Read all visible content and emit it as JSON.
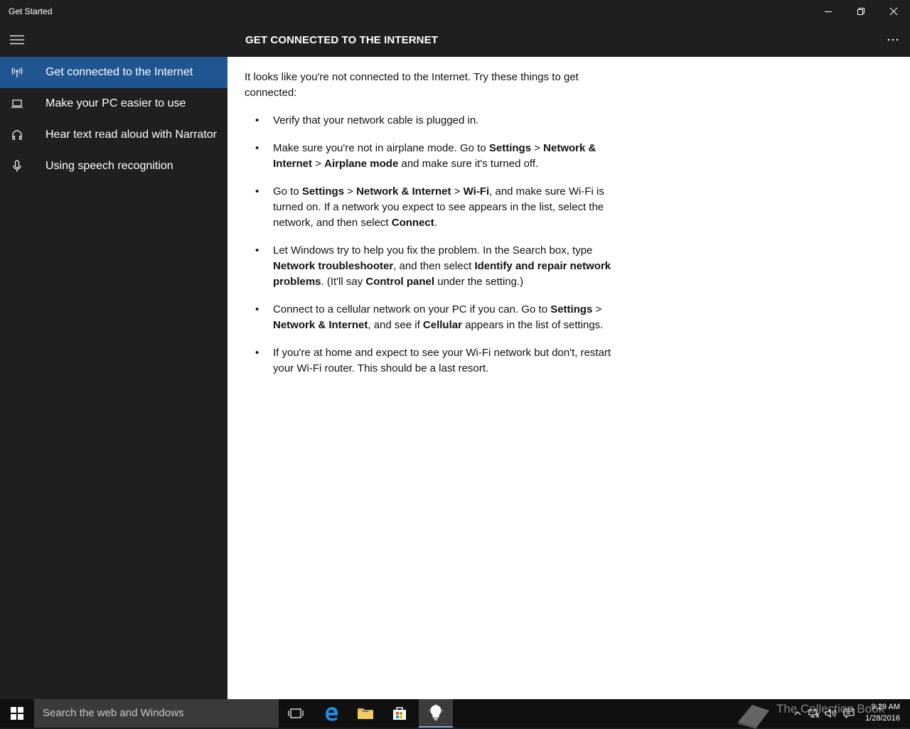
{
  "window": {
    "title": "Get Started"
  },
  "header": {
    "title": "GET CONNECTED TO THE INTERNET"
  },
  "sidebar": {
    "items": [
      {
        "label": "Get connected to the Internet",
        "icon": "antenna-icon",
        "selected": true
      },
      {
        "label": "Make your PC easier to use",
        "icon": "laptop-icon"
      },
      {
        "label": "Hear text read aloud with Narrator",
        "icon": "headphones-icon"
      },
      {
        "label": "Using speech recognition",
        "icon": "microphone-icon"
      }
    ]
  },
  "content": {
    "intro": "It looks like you're not connected to the Internet. Try these things to get connected:",
    "bullet": "•",
    "tips": [
      {
        "p": [
          "Verify that your network cable is plugged in."
        ]
      },
      {
        "p": [
          "Make sure you're not in airplane mode. Go to ",
          "Settings",
          " > ",
          "Network & Internet",
          " > ",
          "Airplane mode",
          " and make sure it's turned off."
        ]
      },
      {
        "p": [
          "Go to ",
          "Settings",
          " > ",
          "Network & Internet",
          " > ",
          "Wi-Fi",
          ", and make sure Wi-Fi is turned on. If a network you expect to see appears in the list, select the network, and then select ",
          "Connect",
          "."
        ]
      },
      {
        "p": [
          "Let Windows try to help you fix the problem. In the Search box, type ",
          "Network troubleshooter",
          ", and then select ",
          "Identify and repair network problems",
          ". (It'll say ",
          "Control panel",
          " under the setting.)"
        ]
      },
      {
        "p": [
          "Connect to a cellular network on your PC if you can. Go to ",
          "Settings",
          " > ",
          "Network & Internet",
          ", and see if ",
          "Cellular",
          " appears in the list of settings."
        ]
      },
      {
        "p": [
          "If you're at home and expect to see your Wi-Fi network but don't, restart your Wi-Fi router. This should be a last resort."
        ]
      }
    ]
  },
  "taskbar": {
    "search_placeholder": "Search the web and Windows",
    "time": "9:29 AM",
    "date": "1/28/2016",
    "watermark": "The Collection Book"
  },
  "colors": {
    "accent": "#1f5590",
    "chrome": "#1f1f1f",
    "taskbar": "#101010",
    "content_bg": "#ffffff"
  }
}
